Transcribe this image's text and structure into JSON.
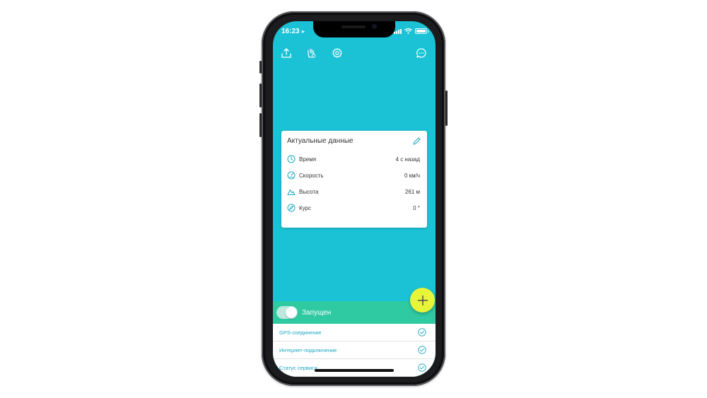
{
  "status_bar": {
    "time": "16:23"
  },
  "toolbar": {
    "icons": [
      "upload-icon",
      "hand-icon",
      "gear-icon",
      "chat-icon"
    ]
  },
  "card": {
    "title": "Актуальные данные",
    "rows": [
      {
        "icon": "clock-icon",
        "label": "Время",
        "value": "4 с назад"
      },
      {
        "icon": "speedometer-icon",
        "label": "Скорость",
        "value": "0 км/ч"
      },
      {
        "icon": "mountain-icon",
        "label": "Высота",
        "value": "261 м"
      },
      {
        "icon": "compass-icon",
        "label": "Курс",
        "value": "0 °"
      }
    ]
  },
  "service": {
    "toggle_label": "Запущен",
    "toggle_on": true
  },
  "checks": [
    {
      "label": "GPS-соединение",
      "ok": true
    },
    {
      "label": "Интернет-подключение",
      "ok": true
    },
    {
      "label": "Статус сервиса",
      "ok": true
    }
  ],
  "colors": {
    "screen_bg": "#1bc2d5",
    "status_bar_green": "#2fc9a2",
    "fab_yellow": "#e7f53a",
    "link_blue": "#1aa8c2"
  }
}
